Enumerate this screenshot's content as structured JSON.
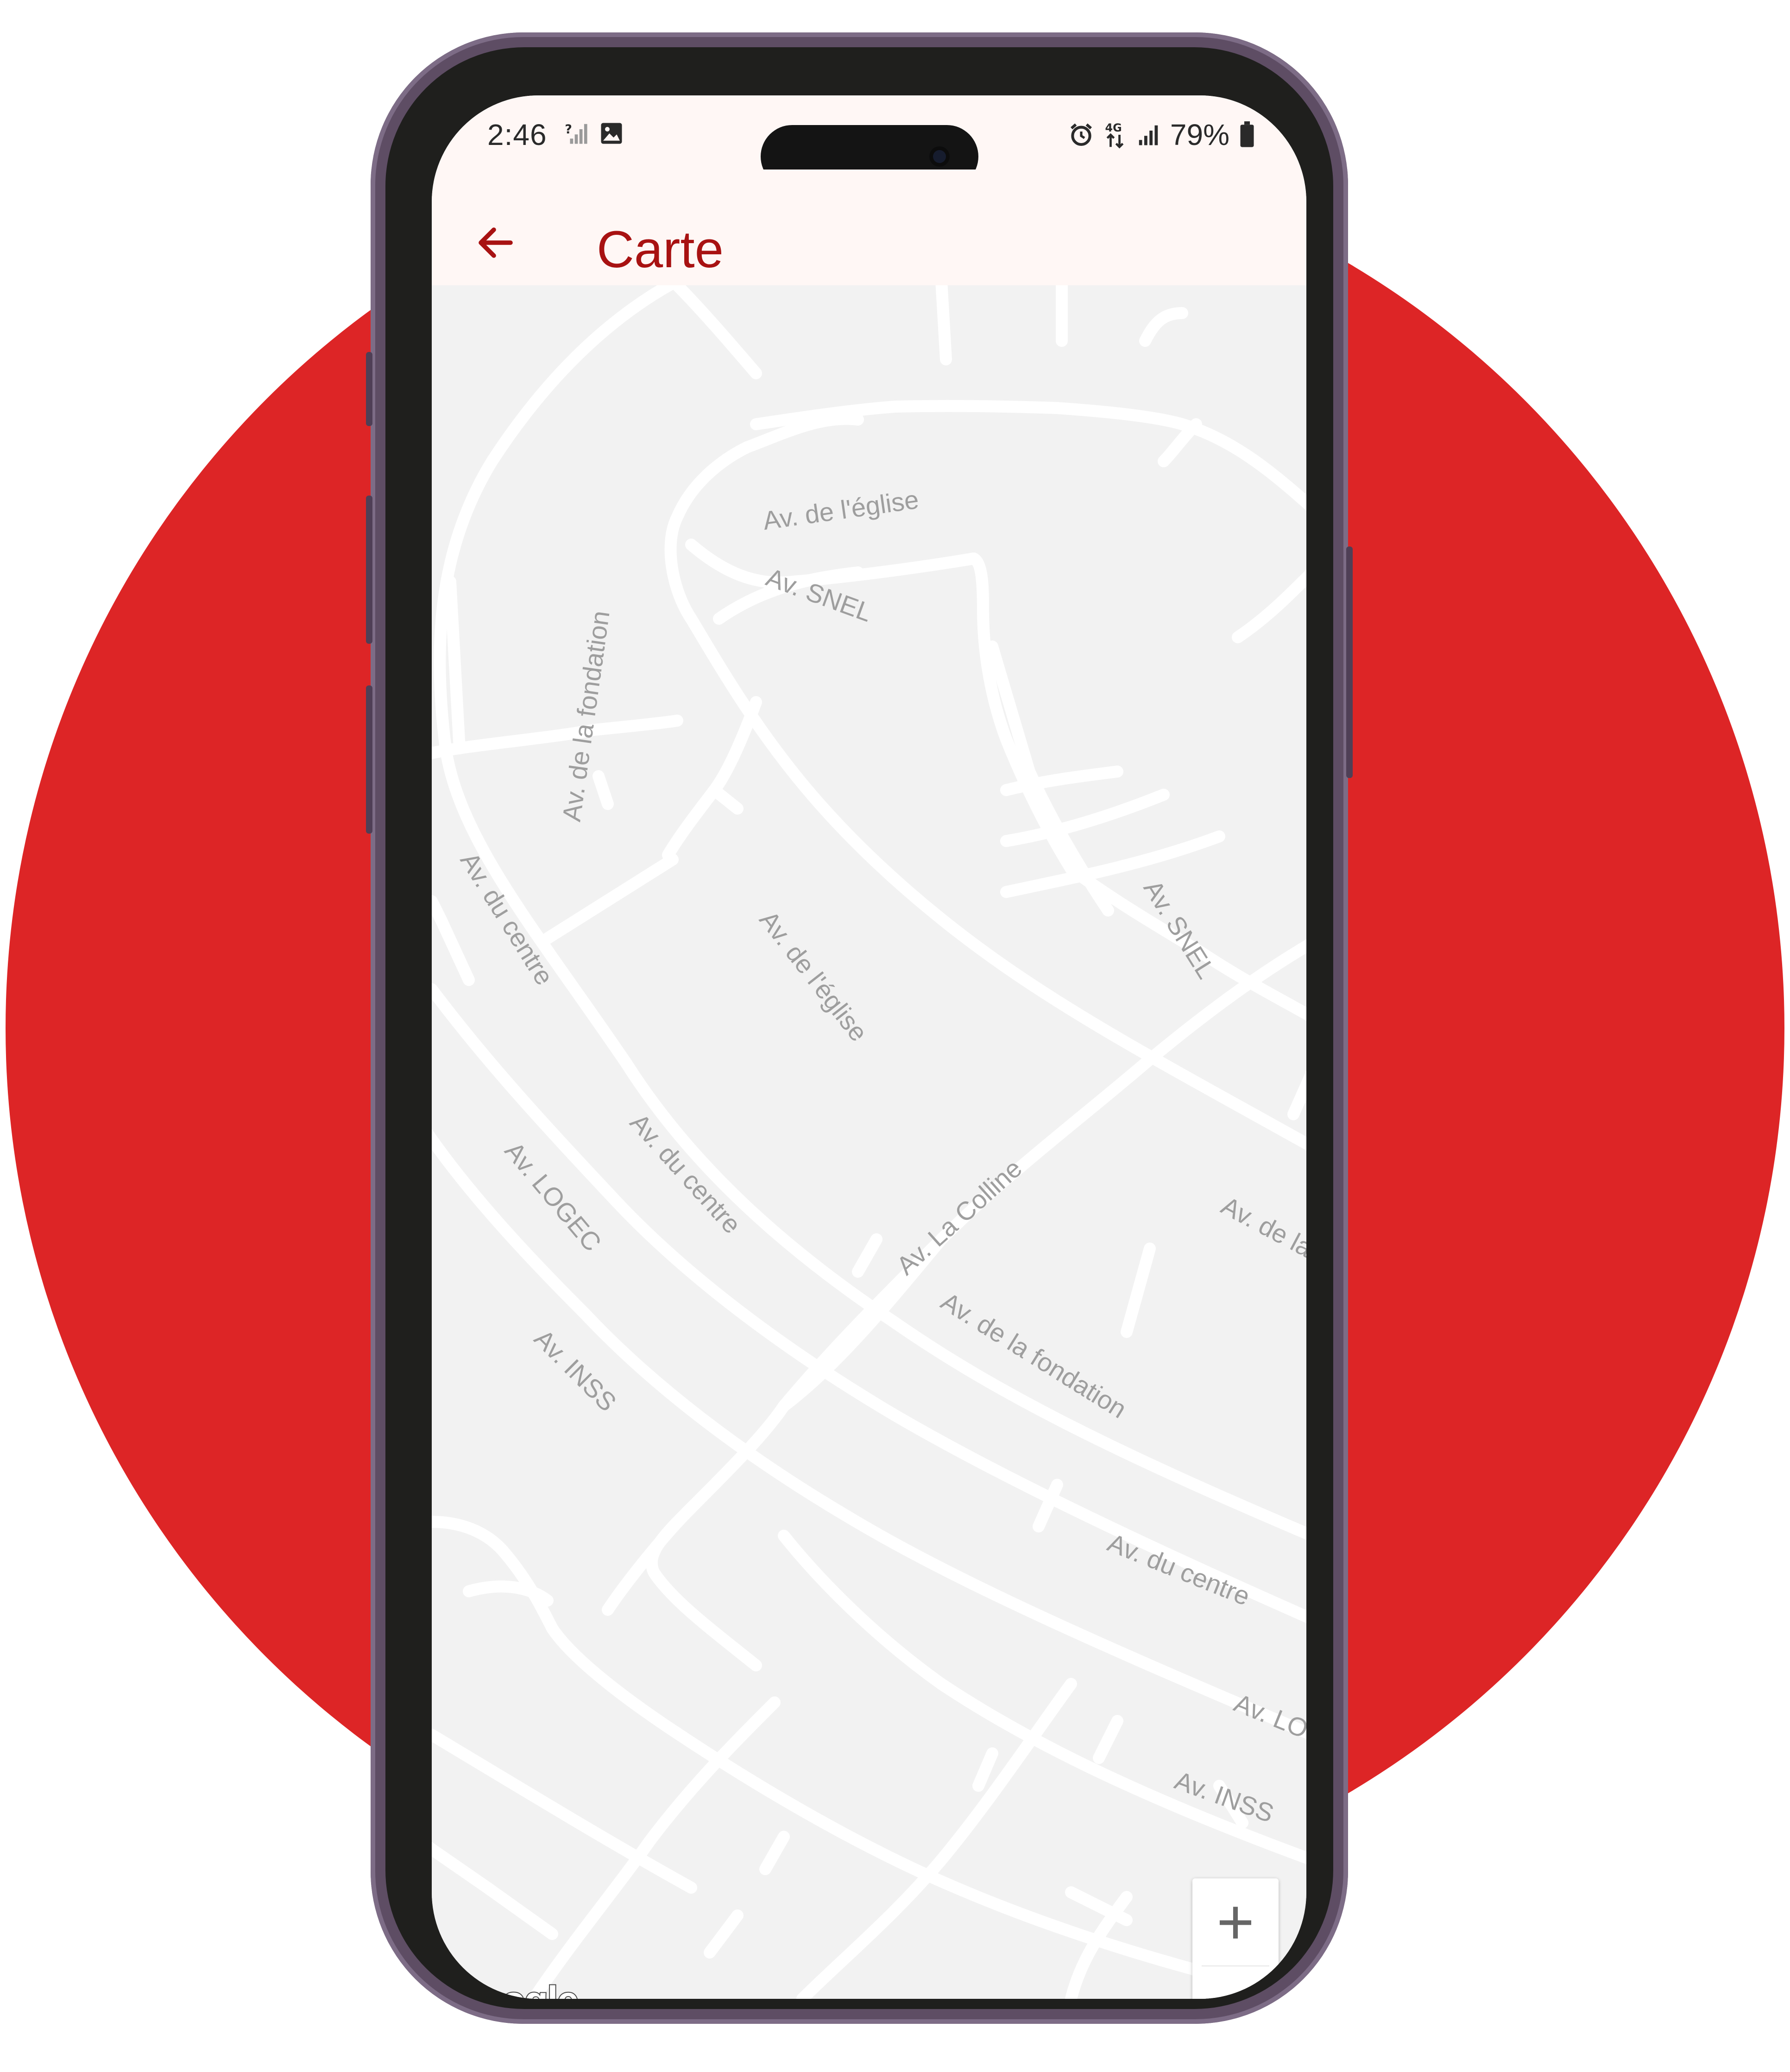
{
  "status_bar": {
    "time": "2:46",
    "battery": "79%",
    "left_icons": [
      "wifi-question-icon",
      "image-icon"
    ],
    "right_icons": [
      "alarm-icon",
      "4g-data-icon",
      "signal-icon",
      "battery-icon"
    ]
  },
  "app_bar": {
    "back_icon": "arrow-left-icon",
    "title": "Carte"
  },
  "map": {
    "street_labels": [
      "Av. de l'église",
      "Av. SNEL",
      "Av. de la fondation",
      "Av. du centre",
      "Av. de l'église",
      "Av. SNEL",
      "Av. du centre",
      "Av. LOGEC",
      "Av. La Colline",
      "Av. de la",
      "Av. de la fondation",
      "Av. INSS",
      "Av. du centre",
      "Av. LO",
      "Av. INSS"
    ],
    "attribution": "Google",
    "zoom_in_label": "+",
    "zoom_out_label": "−"
  },
  "colors": {
    "brand_red": "#dd2526",
    "title_red": "#a81212",
    "map_background": "#f2f2f2",
    "road": "#ffffff",
    "label": "#9e9e9e"
  }
}
